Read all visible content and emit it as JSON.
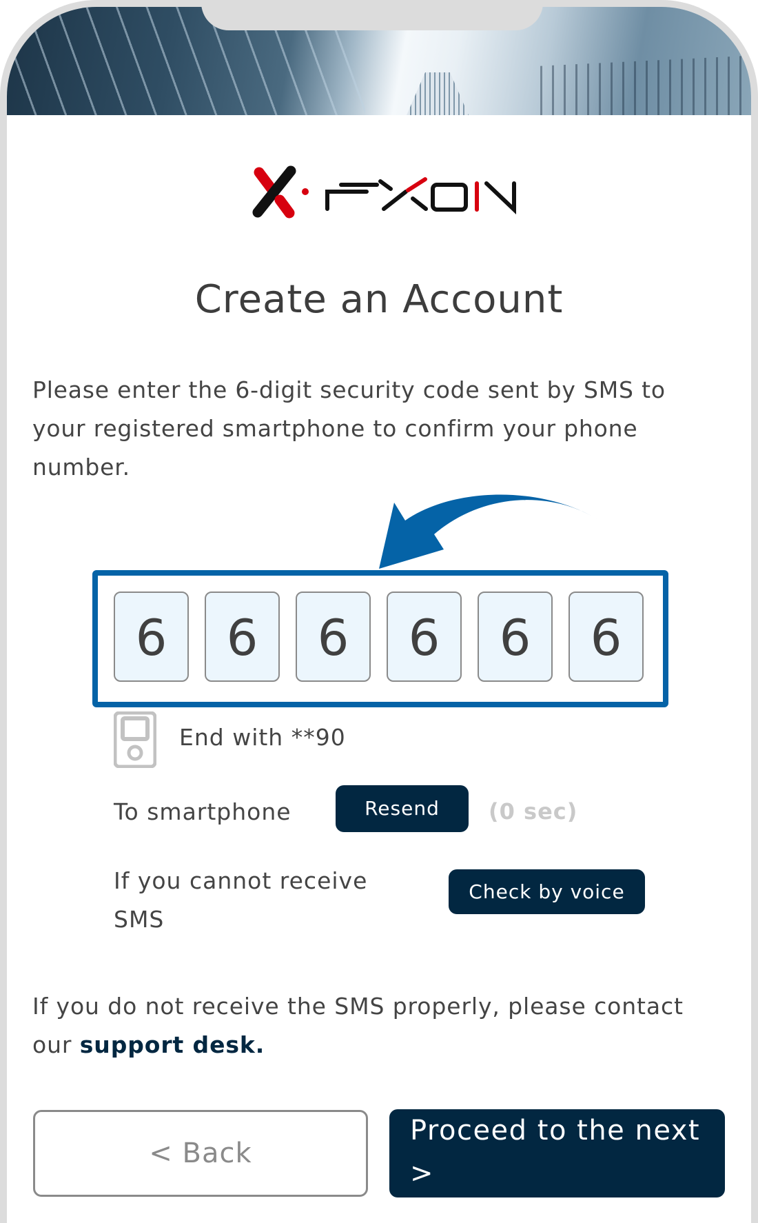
{
  "header": {
    "brand": "FXON"
  },
  "page": {
    "title": "Create an Account",
    "instructions": "Please enter the 6-digit security code sent by SMS to your registered smartphone to confirm your phone number."
  },
  "code": {
    "digits": [
      "6",
      "6",
      "6",
      "6",
      "6",
      "6"
    ]
  },
  "phone": {
    "icon": "phone-icon",
    "ending": "End with **90"
  },
  "resend": {
    "label": "To smartphone",
    "button": "Resend",
    "countdown": "(0 sec)"
  },
  "voice": {
    "label": "If you cannot receive SMS",
    "button": "Check by voice"
  },
  "support": {
    "text": "If you do not receive the SMS properly, please contact our ",
    "link": "support desk."
  },
  "nav": {
    "back": "< Back",
    "next": "Proceed to the next >"
  },
  "colors": {
    "primary": "#022741",
    "highlight": "#0563a7",
    "digit_bg": "#ecf6fd",
    "logo_red": "#d7000f"
  }
}
